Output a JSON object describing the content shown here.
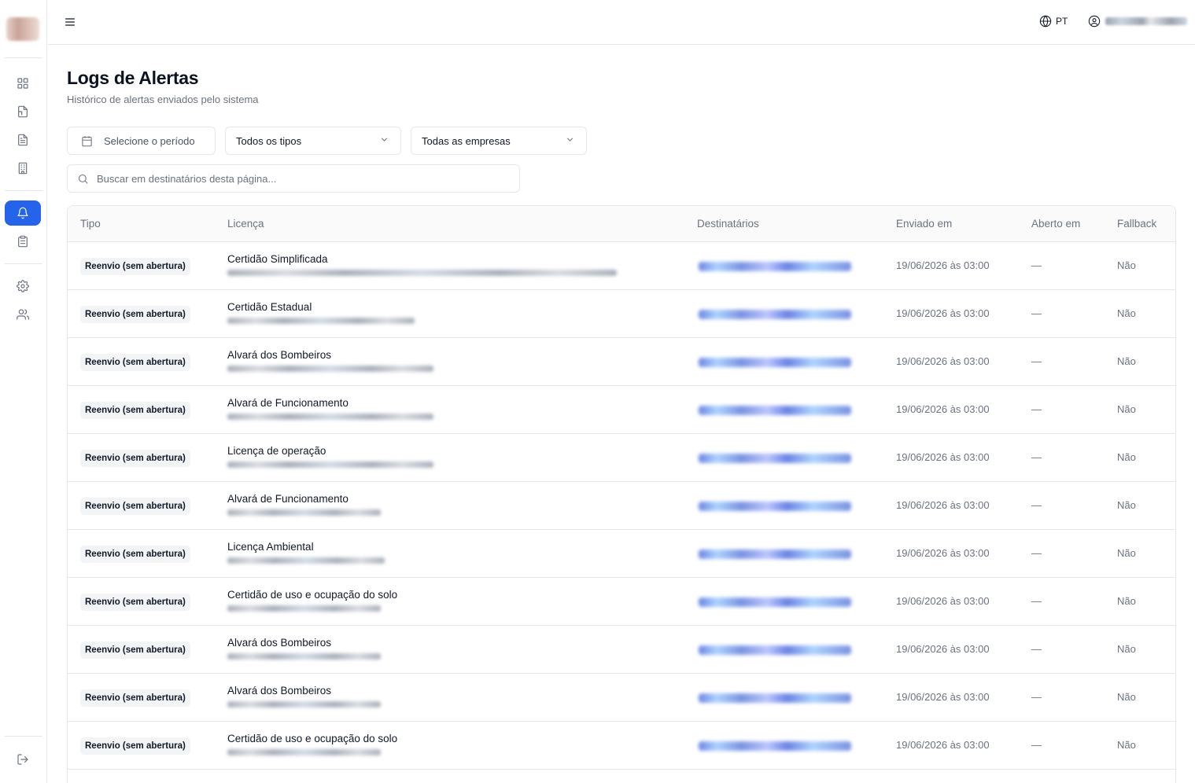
{
  "header": {
    "language": "PT",
    "title": "Logs de Alertas",
    "subtitle": "Histórico de alertas enviados pelo sistema"
  },
  "sidebar": {
    "items": [
      "dashboard-icon",
      "documents-icon",
      "file-icon",
      "building-icon",
      "bell-icon",
      "clipboard-icon",
      "gear-icon",
      "users-icon",
      "logout-icon"
    ],
    "active": "bell-icon"
  },
  "filters": {
    "period_placeholder": "Selecione o período",
    "type_value": "Todos os tipos",
    "company_value": "Todas as empresas",
    "search_placeholder": "Buscar em destinatários desta página..."
  },
  "table": {
    "columns": [
      "Tipo",
      "Licença",
      "Destinatários",
      "Enviado em",
      "Aberto em",
      "Fallback"
    ],
    "rows": [
      {
        "tipo": "Reenvio (sem abertura)",
        "licenca": "Certidão Simplificada",
        "enviado": "19/06/2026 às 03:00",
        "aberto": "—",
        "fallback": "Não"
      },
      {
        "tipo": "Reenvio (sem abertura)",
        "licenca": "Certidão Estadual",
        "enviado": "19/06/2026 às 03:00",
        "aberto": "—",
        "fallback": "Não"
      },
      {
        "tipo": "Reenvio (sem abertura)",
        "licenca": "Alvará dos Bombeiros",
        "enviado": "19/06/2026 às 03:00",
        "aberto": "—",
        "fallback": "Não"
      },
      {
        "tipo": "Reenvio (sem abertura)",
        "licenca": "Alvará de Funcionamento",
        "enviado": "19/06/2026 às 03:00",
        "aberto": "—",
        "fallback": "Não"
      },
      {
        "tipo": "Reenvio (sem abertura)",
        "licenca": "Licença de operação",
        "enviado": "19/06/2026 às 03:00",
        "aberto": "—",
        "fallback": "Não"
      },
      {
        "tipo": "Reenvio (sem abertura)",
        "licenca": "Alvará de Funcionamento",
        "enviado": "19/06/2026 às 03:00",
        "aberto": "—",
        "fallback": "Não"
      },
      {
        "tipo": "Reenvio (sem abertura)",
        "licenca": "Licença Ambiental",
        "enviado": "19/06/2026 às 03:00",
        "aberto": "—",
        "fallback": "Não"
      },
      {
        "tipo": "Reenvio (sem abertura)",
        "licenca": "Certidão de uso e ocupação do solo",
        "enviado": "19/06/2026 às 03:00",
        "aberto": "—",
        "fallback": "Não"
      },
      {
        "tipo": "Reenvio (sem abertura)",
        "licenca": "Alvará dos Bombeiros",
        "enviado": "19/06/2026 às 03:00",
        "aberto": "—",
        "fallback": "Não"
      },
      {
        "tipo": "Reenvio (sem abertura)",
        "licenca": "Alvará dos Bombeiros",
        "enviado": "19/06/2026 às 03:00",
        "aberto": "—",
        "fallback": "Não"
      },
      {
        "tipo": "Reenvio (sem abertura)",
        "licenca": "Certidão de uso e ocupação do solo",
        "enviado": "19/06/2026 às 03:00",
        "aberto": "—",
        "fallback": "Não"
      }
    ]
  }
}
